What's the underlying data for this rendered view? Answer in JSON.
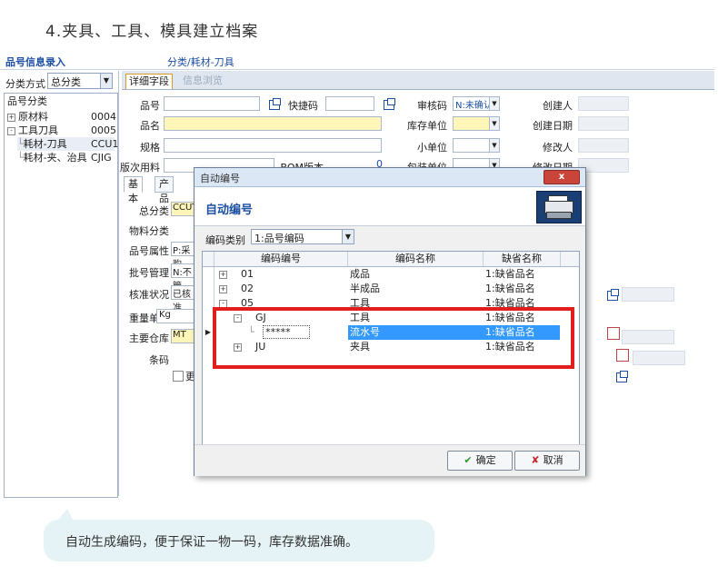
{
  "heading": "4.夹具、工具、模具建立档案",
  "app": {
    "title": "品号信息录入",
    "path": "分类/耗材-刀具",
    "left": {
      "class_label": "分类方式",
      "class_value": "总分类",
      "tree_header": "品号分类",
      "tree": [
        {
          "label": "原材料",
          "code": "0004",
          "prefix": "+"
        },
        {
          "label": "工具刀具",
          "code": "0005",
          "prefix": "-"
        },
        {
          "label": "耗材-刀具",
          "code": "CCU1",
          "prefix": ""
        },
        {
          "label": "耗材-夹、治具",
          "code": "CJIG",
          "prefix": ""
        }
      ]
    },
    "tabs": {
      "detail": "详细字段",
      "info": "信息浏览"
    },
    "fields": {
      "item_no": "品号",
      "quick_code": "快捷码",
      "audit_code": "审核码",
      "audit_value": "N:未确认",
      "creator": "创建人",
      "name": "品名",
      "stock_unit": "库存单位",
      "created_date": "创建日期",
      "spec": "规格",
      "small_unit": "小单位",
      "modifier": "修改人",
      "trial_material": "版次用料",
      "bom": "BOM版本",
      "bom_value": "0",
      "pack_unit": "包装单位",
      "modified_date": "修改日期"
    },
    "basic_tabs": {
      "basic": "基本",
      "product": "产品"
    },
    "form": {
      "total_class": "总分类",
      "total_class_value": "CCUT",
      "material_class": "物料分类",
      "item_attr": "品号属性",
      "item_attr_value": "P:采购",
      "batch_mgmt": "批号管理",
      "batch_value": "N:不管",
      "check_status": "核准状况",
      "check_value": "已核准",
      "weight_unit": "重量单位",
      "weight_value": "Kg",
      "main_warehouse": "主要仓库",
      "warehouse_value": "MT",
      "barcode": "条码",
      "checkbox_label": "更"
    }
  },
  "dialog": {
    "window_title": "自动编号",
    "close": "x",
    "heading": "自动编号",
    "category_label": "编码类别",
    "category_value": "1:品号编码",
    "columns": [
      "编码编号",
      "编码名称",
      "缺省名称"
    ],
    "rows": [
      {
        "code": "01",
        "name": "成品",
        "default": "1:缺省品名",
        "depth": 0,
        "expander": "+"
      },
      {
        "code": "02",
        "name": "半成品",
        "default": "1:缺省品名",
        "depth": 0,
        "expander": "+"
      },
      {
        "code": "05",
        "name": "工具",
        "default": "1:缺省品名",
        "depth": 0,
        "expander": "-"
      },
      {
        "code": "GJ",
        "name": "工具",
        "default": "1:缺省品名",
        "depth": 1,
        "expander": "-"
      },
      {
        "code": "*****",
        "name": "流水号",
        "default": "1:缺省品名",
        "depth": 2,
        "expander": "",
        "selected": true
      },
      {
        "code": "JU",
        "name": "夹具",
        "default": "1:缺省品名",
        "depth": 1,
        "expander": "+"
      }
    ],
    "ok": "确定",
    "cancel": "取消"
  },
  "callout": "自动生成编码，便于保证一物一码，库存数据准确。",
  "colors": {
    "highlight": "#e11d1d",
    "selection": "#3399ff",
    "accent": "#1d4fa3"
  }
}
